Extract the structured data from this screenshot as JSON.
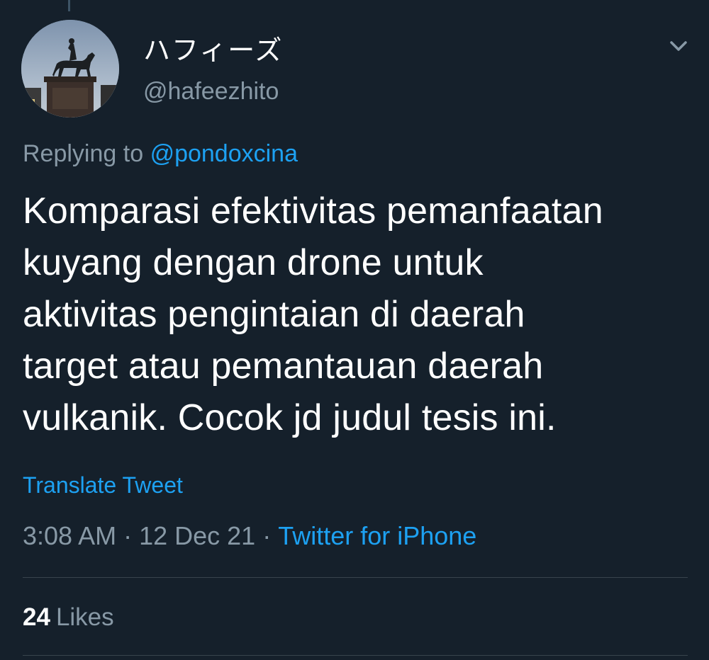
{
  "tweet": {
    "display_name": "ハフィーズ",
    "handle": "@hafeezhito",
    "replying_prefix": "Replying to",
    "replying_to": "@pondoxcina",
    "text_lines": [
      "Komparasi efektivitas pemanfaatan",
      "kuyang dengan drone untuk",
      "aktivitas pengintaian di daerah",
      "target atau pemantauan daerah",
      "vulkanik. Cocok jd judul tesis ini."
    ],
    "translate_label": "Translate Tweet",
    "time": "3:08 AM",
    "date": "12 Dec 21",
    "separator": "·",
    "source": "Twitter for iPhone",
    "likes_count": "24",
    "likes_label": "Likes"
  },
  "icons": {
    "menu": "chevron-down-icon",
    "avatar": "equestrian-statue-photo"
  },
  "colors": {
    "background": "#15202b",
    "accent": "#1da1f2",
    "secondary_text": "#8899a6",
    "primary_text": "#ffffff",
    "divider": "#38444d"
  }
}
